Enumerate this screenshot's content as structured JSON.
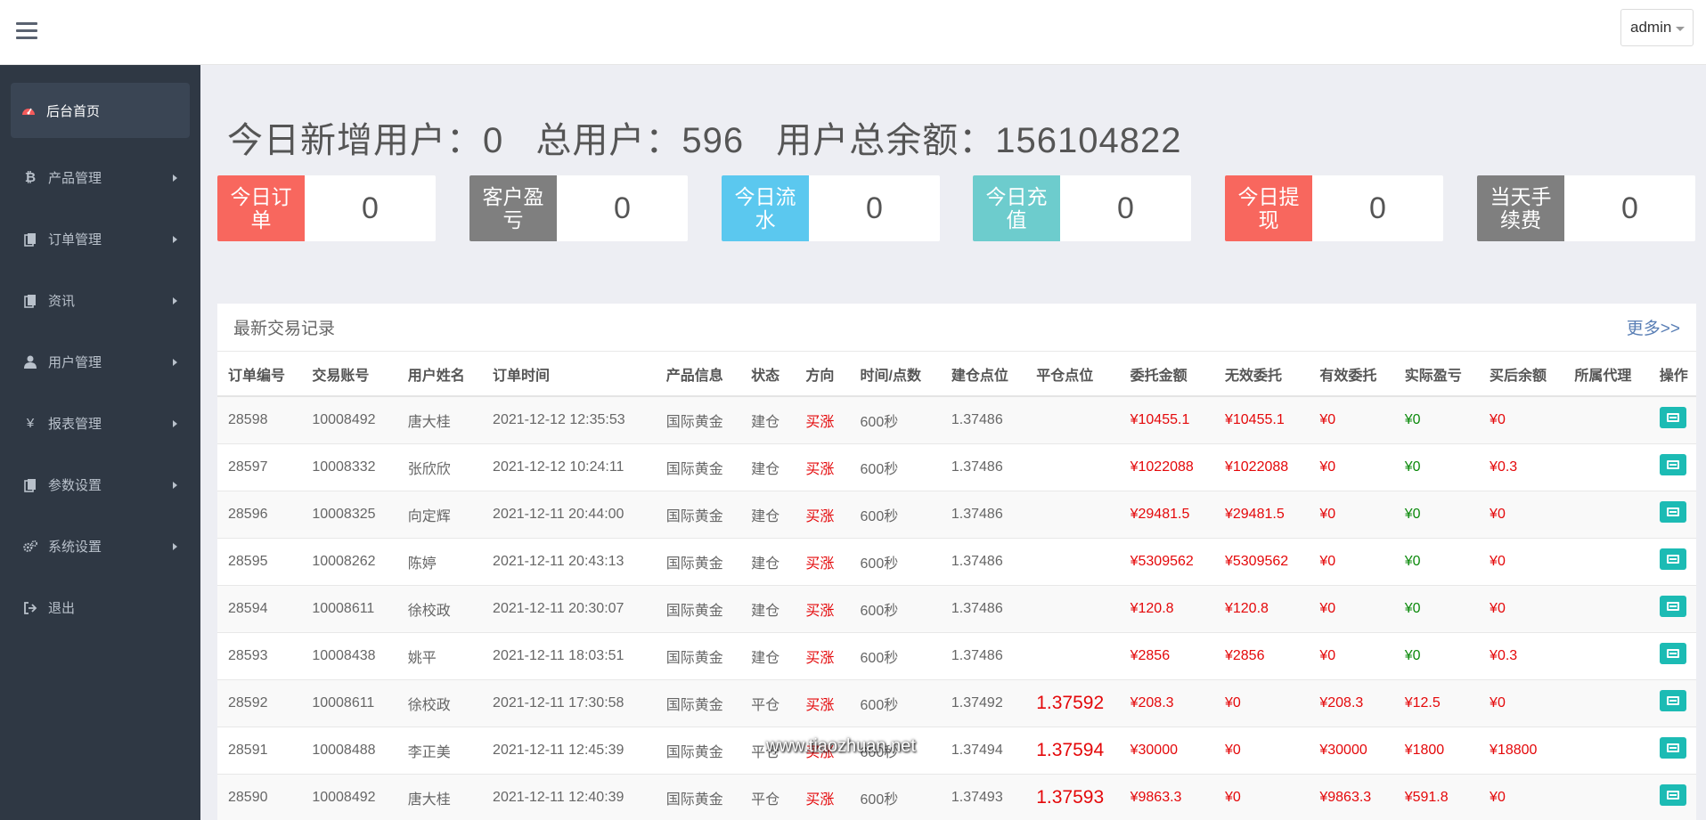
{
  "topbar": {
    "user_label": "admin"
  },
  "sidebar": {
    "items": [
      {
        "label": "后台首页",
        "icon": "dashboard-icon",
        "active": true
      },
      {
        "label": "产品管理",
        "icon": "bitcoin-icon"
      },
      {
        "label": "订单管理",
        "icon": "copy-icon"
      },
      {
        "label": "资讯",
        "icon": "copy-icon"
      },
      {
        "label": "用户管理",
        "icon": "user-icon"
      },
      {
        "label": "报表管理",
        "icon": "yen-icon"
      },
      {
        "label": "参数设置",
        "icon": "copy-icon"
      },
      {
        "label": "系统设置",
        "icon": "gears-icon"
      },
      {
        "label": "退出",
        "icon": "sign-out-icon"
      }
    ]
  },
  "summary": {
    "new_users": "今日新增用户：0",
    "total_users": "总用户：596",
    "total_balance": "用户总余额：156104822"
  },
  "stats": [
    {
      "label": "今日订单",
      "value": "0",
      "color": "#f8675e"
    },
    {
      "label": "客户盈亏",
      "value": "0",
      "color": "#7f7f7f"
    },
    {
      "label": "今日流水",
      "value": "0",
      "color": "#5bc8ef"
    },
    {
      "label": "今日充值",
      "value": "0",
      "color": "#6dcccd"
    },
    {
      "label": "今日提现",
      "value": "0",
      "color": "#f8675e"
    },
    {
      "label": "当天手续费",
      "value": "0",
      "color": "#7f7f7f"
    }
  ],
  "trades": {
    "title": "最新交易记录",
    "more": "更多>>",
    "columns": [
      "订单编号",
      "交易账号",
      "用户姓名",
      "订单时间",
      "产品信息",
      "状态",
      "方向",
      "时间/点数",
      "建仓点位",
      "平仓点位",
      "委托金额",
      "无效委托",
      "有效委托",
      "实际盈亏",
      "买后余额",
      "所属代理",
      "操作"
    ],
    "rows": [
      [
        "28598",
        "10008492",
        "唐大桂",
        "2021-12-12 12:35:53",
        "国际黄金",
        "建仓",
        "买涨",
        "600秒",
        "1.37486",
        "",
        "¥10455.1",
        "¥10455.1",
        "¥0",
        "¥0",
        "¥0",
        ""
      ],
      [
        "28597",
        "10008332",
        "张欣欣",
        "2021-12-12 10:24:11",
        "国际黄金",
        "建仓",
        "买涨",
        "600秒",
        "1.37486",
        "",
        "¥1022088",
        "¥1022088",
        "¥0",
        "¥0",
        "¥0.3",
        ""
      ],
      [
        "28596",
        "10008325",
        "向定辉",
        "2021-12-11 20:44:00",
        "国际黄金",
        "建仓",
        "买涨",
        "600秒",
        "1.37486",
        "",
        "¥29481.5",
        "¥29481.5",
        "¥0",
        "¥0",
        "¥0",
        ""
      ],
      [
        "28595",
        "10008262",
        "陈婷",
        "2021-12-11 20:43:13",
        "国际黄金",
        "建仓",
        "买涨",
        "600秒",
        "1.37486",
        "",
        "¥5309562",
        "¥5309562",
        "¥0",
        "¥0",
        "¥0",
        ""
      ],
      [
        "28594",
        "10008611",
        "徐校政",
        "2021-12-11 20:30:07",
        "国际黄金",
        "建仓",
        "买涨",
        "600秒",
        "1.37486",
        "",
        "¥120.8",
        "¥120.8",
        "¥0",
        "¥0",
        "¥0",
        ""
      ],
      [
        "28593",
        "10008438",
        "姚平",
        "2021-12-11 18:03:51",
        "国际黄金",
        "建仓",
        "买涨",
        "600秒",
        "1.37486",
        "",
        "¥2856",
        "¥2856",
        "¥0",
        "¥0",
        "¥0.3",
        ""
      ],
      [
        "28592",
        "10008611",
        "徐校政",
        "2021-12-11 17:30:58",
        "国际黄金",
        "平仓",
        "买涨",
        "600秒",
        "1.37492",
        "1.37592",
        "¥208.3",
        "¥0",
        "¥208.3",
        "¥12.5",
        "¥0",
        ""
      ],
      [
        "28591",
        "10008488",
        "李正美",
        "2021-12-11 12:45:39",
        "国际黄金",
        "平仓",
        "买涨",
        "600秒",
        "1.37494",
        "1.37594",
        "¥30000",
        "¥0",
        "¥30000",
        "¥1800",
        "¥18800",
        ""
      ],
      [
        "28590",
        "10008492",
        "唐大桂",
        "2021-12-11 12:40:39",
        "国际黄金",
        "平仓",
        "买涨",
        "600秒",
        "1.37493",
        "1.37593",
        "¥9863.3",
        "¥0",
        "¥9863.3",
        "¥591.8",
        "¥0",
        ""
      ]
    ]
  },
  "watermark": "www.tiaozhuan.net"
}
